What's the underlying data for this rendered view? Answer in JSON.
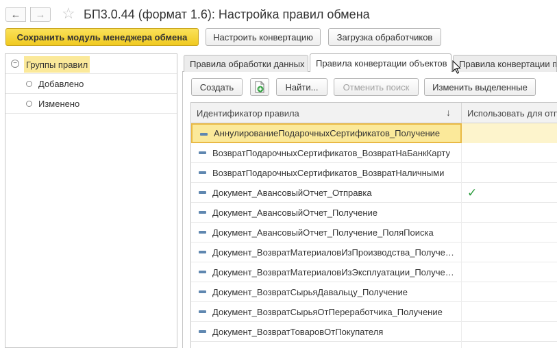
{
  "window": {
    "title": "БП3.0.44 (формат 1.6): Настройка правил обмена",
    "back_icon": "arrow-left-icon",
    "forward_icon": "arrow-right-icon",
    "favorite_icon": "star-icon"
  },
  "toolbar": {
    "save_label": "Сохранить модуль менеджера обмена",
    "configure_label": "Настроить конвертацию",
    "load_handlers_label": "Загрузка обработчиков"
  },
  "tree": {
    "root": "Группы правил",
    "items": [
      {
        "label": "Добавлено"
      },
      {
        "label": "Изменено"
      }
    ]
  },
  "tabs": [
    {
      "label": "Правила обработки данных",
      "active": false
    },
    {
      "label": "Правила конвертации объектов",
      "active": true
    },
    {
      "label": "Правила конвертации пр",
      "active": false
    }
  ],
  "panel_toolbar": {
    "create_label": "Создать",
    "find_label": "Найти...",
    "cancel_search_label": "Отменить поиск",
    "change_selected_label": "Изменить выделенные"
  },
  "table": {
    "columns": [
      "Идентификатор правила",
      "Использовать для отп"
    ],
    "rows": [
      {
        "id": "АннулированиеПодарочныхСертификатов_Получение",
        "use": ""
      },
      {
        "id": "ВозвратПодарочныхСертификатов_ВозвратНаБанкКарту",
        "use": ""
      },
      {
        "id": "ВозвратПодарочныхСертификатов_ВозвратНаличными",
        "use": ""
      },
      {
        "id": "Документ_АвансовыйОтчет_Отправка",
        "use": "✓"
      },
      {
        "id": "Документ_АвансовыйОтчет_Получение",
        "use": ""
      },
      {
        "id": "Документ_АвансовыйОтчет_Получение_ПоляПоиска",
        "use": ""
      },
      {
        "id": "Документ_ВозвратМатериаловИзПроизводства_Получение",
        "use": ""
      },
      {
        "id": "Документ_ВозвратМатериаловИзЭксплуатации_Получение",
        "use": ""
      },
      {
        "id": "Документ_ВозвратСырьяДавальцу_Получение",
        "use": ""
      },
      {
        "id": "Документ_ВозвратСырьяОтПереработчика_Получение",
        "use": ""
      },
      {
        "id": "Документ_ВозвратТоваровОтПокупателя",
        "use": ""
      },
      {
        "id": "",
        "use": "✓"
      }
    ]
  }
}
